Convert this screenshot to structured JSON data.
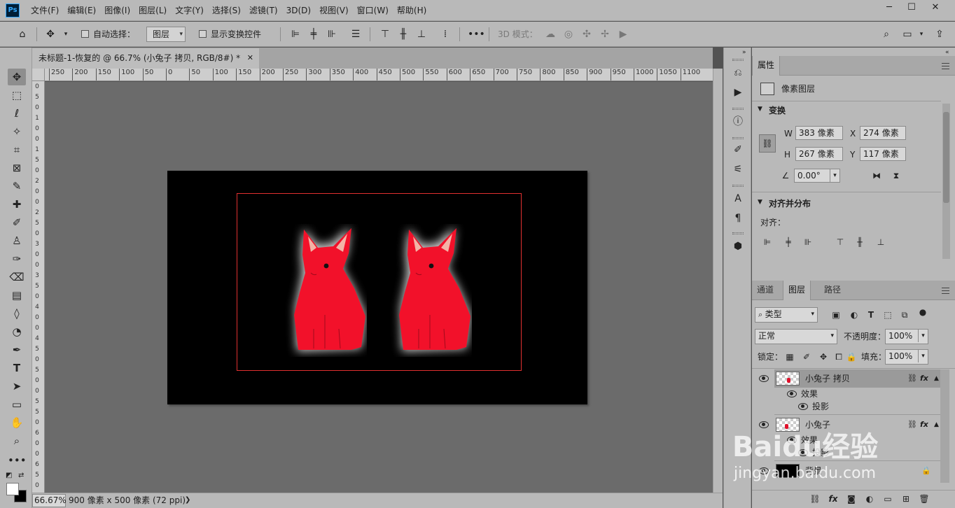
{
  "app": {
    "logo": "Ps"
  },
  "menu": [
    "文件(F)",
    "编辑(E)",
    "图像(I)",
    "图层(L)",
    "文字(Y)",
    "选择(S)",
    "滤镜(T)",
    "3D(D)",
    "视图(V)",
    "窗口(W)",
    "帮助(H)"
  ],
  "window_controls": {
    "minimize": "─",
    "maximize": "☐",
    "close": "✕"
  },
  "options": {
    "auto_select_label": "自动选择：",
    "auto_select_value": "图层",
    "show_transform_label": "显示变换控件",
    "mode_3d_label": "3D 模式："
  },
  "document": {
    "tab_title": "未标题-1-恢复的 @ 66.7% (小兔子 拷贝, RGB/8#) *",
    "close": "✕",
    "zoom": "66.67%",
    "size_info": "900 像素 x 500 像素 (72 ppi)"
  },
  "ruler": {
    "top": [
      "250",
      "200",
      "150",
      "100",
      "50",
      "0",
      "50",
      "100",
      "150",
      "200",
      "250",
      "300",
      "350",
      "400",
      "450",
      "500",
      "550",
      "600",
      "650",
      "700",
      "750",
      "800",
      "850",
      "900",
      "950",
      "1000",
      "1050",
      "1100"
    ],
    "left": [
      "0",
      "5",
      "0",
      "1",
      "0",
      "0",
      "1",
      "5",
      "0",
      "2",
      "0",
      "0",
      "2",
      "5",
      "0",
      "3",
      "0",
      "0",
      "3",
      "5",
      "0",
      "4",
      "0",
      "0",
      "4",
      "5",
      "0",
      "5",
      "0",
      "0",
      "5",
      "5",
      "0",
      "6",
      "0",
      "0",
      "6",
      "5",
      "0"
    ]
  },
  "properties": {
    "tab": "属性",
    "kind": "像素图层",
    "transform_title": "变换",
    "w_label": "W",
    "w_value": "383 像素",
    "h_label": "H",
    "h_value": "267 像素",
    "x_label": "X",
    "x_value": "274 像素",
    "y_label": "Y",
    "y_value": "117 像素",
    "angle_value": "0.00°",
    "align_title": "对齐并分布",
    "align_label": "对齐："
  },
  "layers_panel": {
    "tabs": [
      "通道",
      "图层",
      "路径"
    ],
    "active_tab": "图层",
    "filter_value": "类型",
    "blend_mode": "正常",
    "opacity_label": "不透明度：",
    "opacity_value": "100%",
    "lock_label": "锁定：",
    "fill_label": "填充：",
    "fill_value": "100%",
    "layers": [
      {
        "name": "小兔子 拷贝",
        "effects_label": "效果",
        "effect": "投影"
      },
      {
        "name": "小兔子",
        "effects_label": "效果",
        "effect": "投影"
      },
      {
        "name": "背景"
      }
    ]
  },
  "watermark": {
    "brand": "Baidu经验",
    "url": "jingyan.baidu.com"
  },
  "colors": {
    "bunny": "#f2112a",
    "bunny_ear": "#f3b3a6",
    "selection": "#e03030"
  }
}
